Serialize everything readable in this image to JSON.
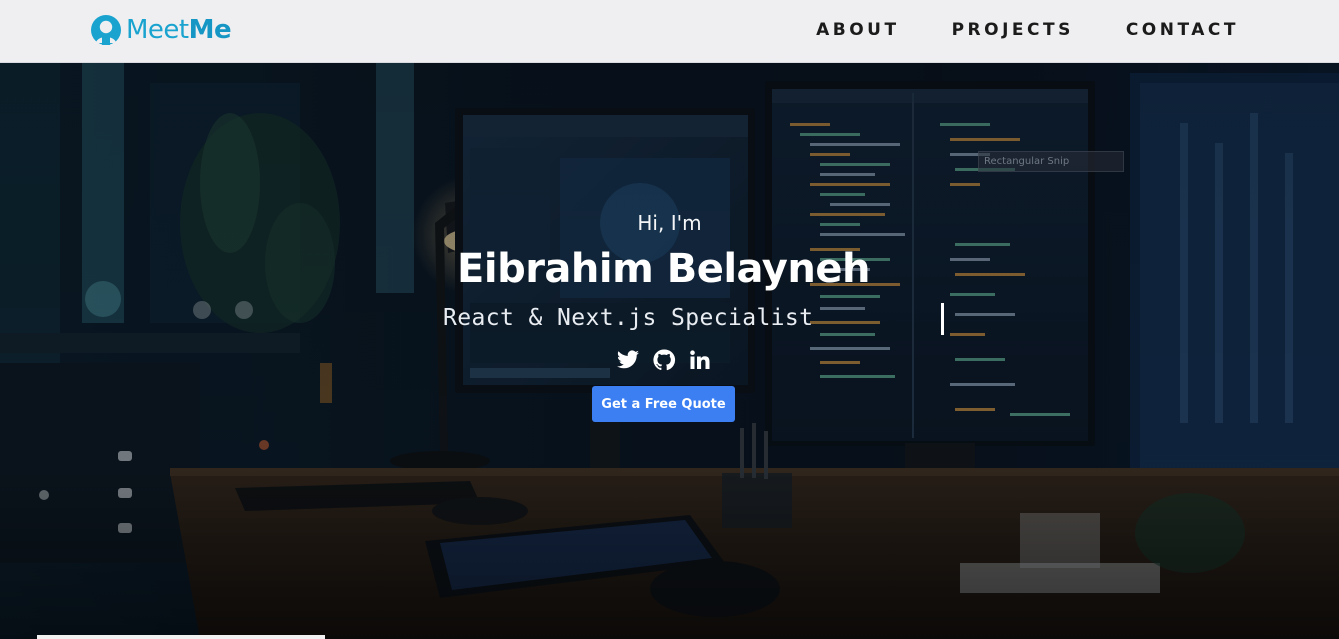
{
  "brand": {
    "name_regular": "Meet",
    "name_bold": "Me",
    "icon": "user-avatar-icon",
    "color": "#1aa3cf"
  },
  "nav": {
    "items": [
      {
        "label": "ABOUT"
      },
      {
        "label": "PROJECTS"
      },
      {
        "label": "CONTACT"
      }
    ]
  },
  "hero": {
    "greeting": "Hi, I'm",
    "name": "Eibrahim Belayneh",
    "role": "React & Next.js Specialist",
    "cta_label": "Get a Free Quote",
    "cta_color": "#3b7ff3",
    "socials": [
      {
        "icon": "twitter-icon"
      },
      {
        "icon": "github-icon"
      },
      {
        "icon": "linkedin-icon"
      }
    ],
    "overlay_text": "Rectangular Snip"
  }
}
